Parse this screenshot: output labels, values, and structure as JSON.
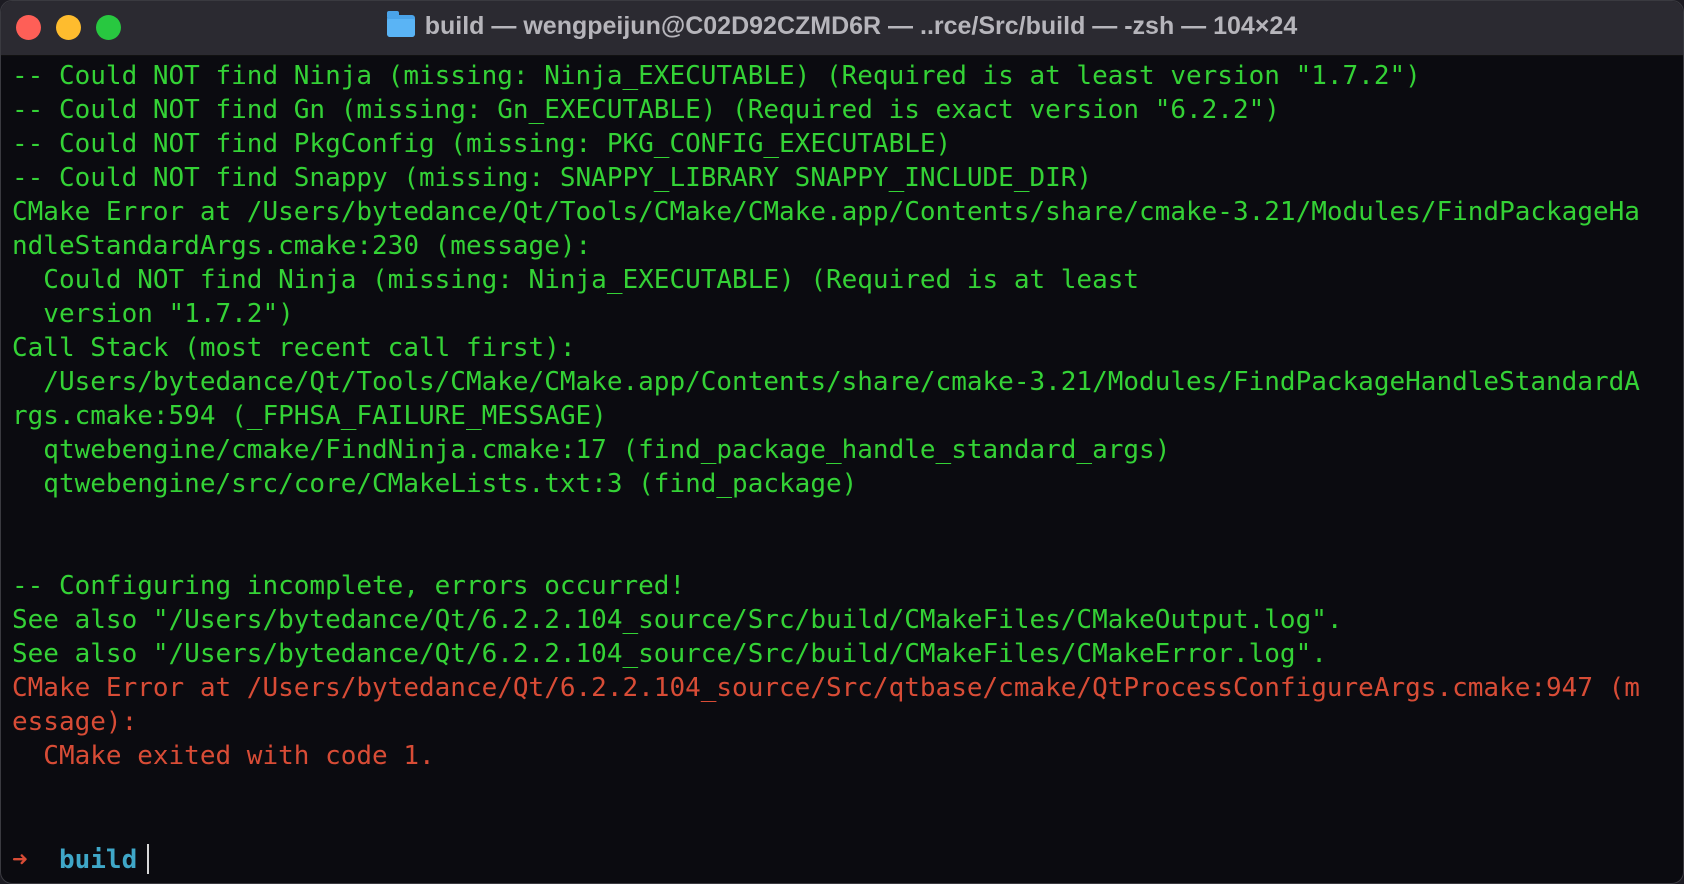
{
  "window": {
    "title": "build — wengpeijun@C02D92CZMD6R — ..rce/Src/build — -zsh — 104×24",
    "title_icon": "folder-icon"
  },
  "colors": {
    "output_text": "#34d236",
    "error_text": "#d84c36",
    "prompt_dir": "#3fa7c8",
    "background": "#0b0b10",
    "titlebar": "#2b2a31"
  },
  "terminal": {
    "lines": [
      {
        "text": "-- Could NOT find Ninja (missing: Ninja_EXECUTABLE) (Required is at least version \"1.7.2\")",
        "color": "green"
      },
      {
        "text": "-- Could NOT find Gn (missing: Gn_EXECUTABLE) (Required is exact version \"6.2.2\")",
        "color": "green"
      },
      {
        "text": "-- Could NOT find PkgConfig (missing: PKG_CONFIG_EXECUTABLE)",
        "color": "green"
      },
      {
        "text": "-- Could NOT find Snappy (missing: SNAPPY_LIBRARY SNAPPY_INCLUDE_DIR)",
        "color": "green"
      },
      {
        "text": "CMake Error at /Users/bytedance/Qt/Tools/CMake/CMake.app/Contents/share/cmake-3.21/Modules/FindPackageHa",
        "color": "green"
      },
      {
        "text": "ndleStandardArgs.cmake:230 (message):",
        "color": "green"
      },
      {
        "text": "  Could NOT find Ninja (missing: Ninja_EXECUTABLE) (Required is at least",
        "color": "green"
      },
      {
        "text": "  version \"1.7.2\")",
        "color": "green"
      },
      {
        "text": "Call Stack (most recent call first):",
        "color": "green"
      },
      {
        "text": "  /Users/bytedance/Qt/Tools/CMake/CMake.app/Contents/share/cmake-3.21/Modules/FindPackageHandleStandardA",
        "color": "green"
      },
      {
        "text": "rgs.cmake:594 (_FPHSA_FAILURE_MESSAGE)",
        "color": "green"
      },
      {
        "text": "  qtwebengine/cmake/FindNinja.cmake:17 (find_package_handle_standard_args)",
        "color": "green"
      },
      {
        "text": "  qtwebengine/src/core/CMakeLists.txt:3 (find_package)",
        "color": "green"
      },
      {
        "text": "",
        "color": "green"
      },
      {
        "text": "",
        "color": "green"
      },
      {
        "text": "-- Configuring incomplete, errors occurred!",
        "color": "green"
      },
      {
        "text": "See also \"/Users/bytedance/Qt/6.2.2.104_source/Src/build/CMakeFiles/CMakeOutput.log\".",
        "color": "green"
      },
      {
        "text": "See also \"/Users/bytedance/Qt/6.2.2.104_source/Src/build/CMakeFiles/CMakeError.log\".",
        "color": "green"
      },
      {
        "text": "CMake Error at /Users/bytedance/Qt/6.2.2.104_source/Src/qtbase/cmake/QtProcessConfigureArgs.cmake:947 (m",
        "color": "red"
      },
      {
        "text": "essage):",
        "color": "red"
      },
      {
        "text": "  CMake exited with code 1.",
        "color": "red"
      }
    ]
  },
  "prompt": {
    "arrow": "➜",
    "directory": "build"
  }
}
